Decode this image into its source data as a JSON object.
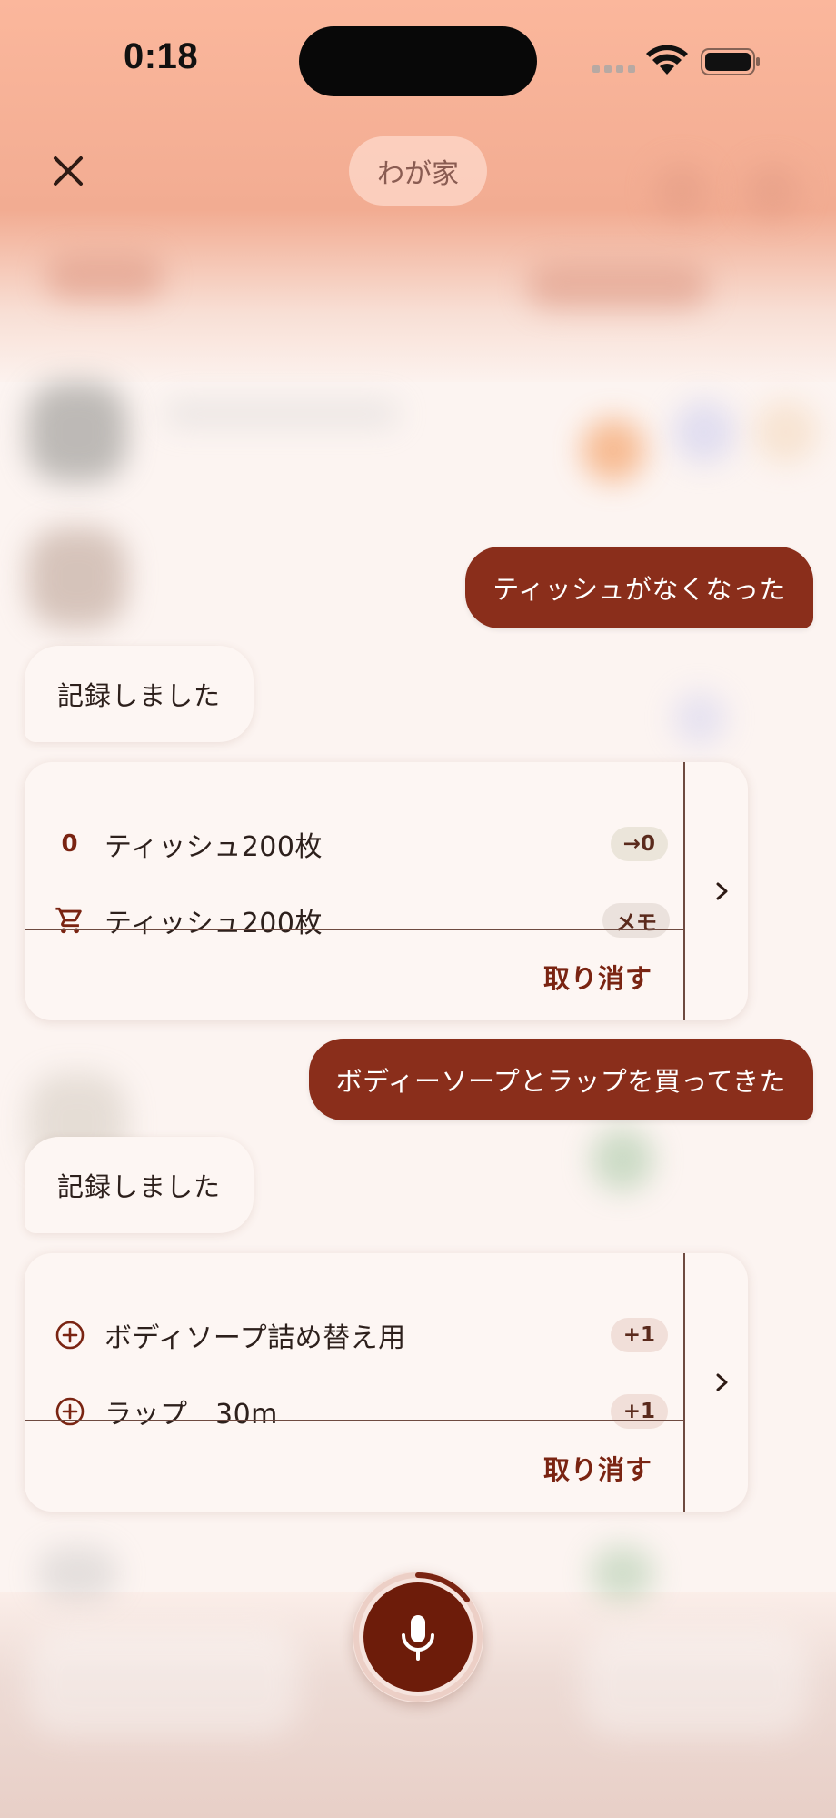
{
  "status_bar": {
    "time": "0:18"
  },
  "header": {
    "title": "わが家"
  },
  "messages": [
    {
      "role": "user",
      "text": "ティッシュがなくなった"
    },
    {
      "role": "assistant",
      "text": "記録しました"
    },
    {
      "role": "user",
      "text": "ボディーソープとラップを買ってきた"
    },
    {
      "role": "assistant",
      "text": "記録しました"
    }
  ],
  "cards": [
    {
      "items": [
        {
          "lead": "0",
          "lead_icon": "",
          "name": "ティッシュ200枚",
          "badge": "→0"
        },
        {
          "lead": "",
          "lead_icon": "cart-icon",
          "name": "ティッシュ200枚",
          "badge": "メモ"
        }
      ],
      "undo_label": "取り消す"
    },
    {
      "items": [
        {
          "lead": "",
          "lead_icon": "plus-circle-icon",
          "name": "ボディソープ詰め替え用",
          "badge": "+1"
        },
        {
          "lead": "",
          "lead_icon": "plus-circle-icon",
          "name": "ラップ　30m",
          "badge": "+1"
        }
      ],
      "undo_label": "取り消す"
    }
  ],
  "colors": {
    "accent": "#8a2e1b",
    "mic": "#6d1c0a",
    "badge_neutral": "#ebe2d9",
    "badge_plus": "#f1dfd9"
  },
  "icons": {
    "close": "close-icon",
    "mic": "mic-icon",
    "chevron": "chevron-right-icon"
  }
}
